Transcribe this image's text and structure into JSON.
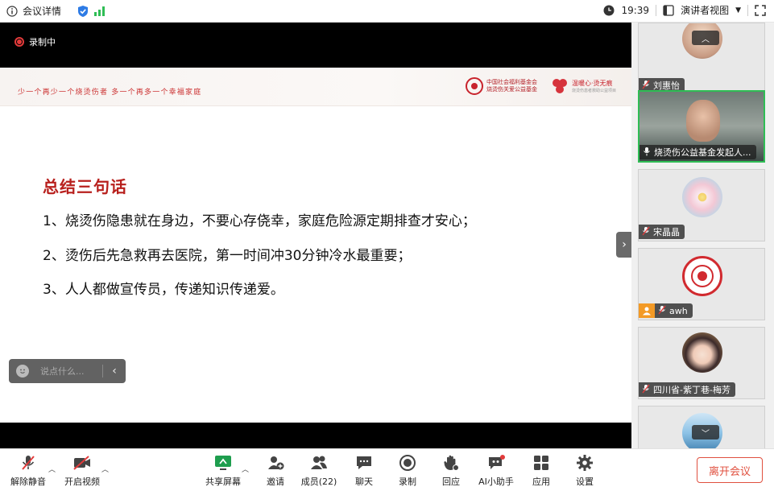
{
  "titlebar": {
    "title": "会议详情",
    "time": "19:39",
    "view_label": "演讲者视图"
  },
  "stage": {
    "recording_label": "录制中",
    "slide": {
      "slogan": "少一个再少一个烧烫伤者 多一个再多一个幸福家庭",
      "logo1_line1": "中国社会福利基金会",
      "logo1_line2": "烧烫伤关爱公益基金",
      "logo2_line1": "温暖心·烫无痕",
      "logo2_line2": "烧烫伤患者救助公益项目",
      "heading": "总结三句话",
      "lines": [
        "1、烧烫伤隐患就在身边，不要心存侥幸，家庭危险源定期排查才安心；",
        "2、烫伤后先急救再去医院，第一时间冲30分钟冷水最重要；",
        "3、人人都做宣传员，传递知识传递爱。"
      ]
    },
    "chat_placeholder": "说点什么..."
  },
  "participants": [
    {
      "name": "刘惠怡",
      "muted": true
    },
    {
      "name": "烧烫伤公益基金发起人...",
      "muted": false,
      "active": true
    },
    {
      "name": "宋晶晶",
      "muted": true
    },
    {
      "name": "awh",
      "muted": true
    },
    {
      "name": "四川省-紫丁巷-梅芳",
      "muted": true
    },
    {
      "name": "",
      "muted": true
    }
  ],
  "toolbar": {
    "unmute": "解除静音",
    "start_video": "开启视频",
    "share_screen": "共享屏幕",
    "invite": "邀请",
    "members": "成员(22)",
    "chat": "聊天",
    "record": "录制",
    "reactions": "回应",
    "ai_assistant": "AI小助手",
    "apps": "应用",
    "settings": "设置",
    "leave": "离开会议"
  },
  "colors": {
    "accent_green": "#2fbd55",
    "heading_red": "#b8201d",
    "leave_red": "#e0503f",
    "record_red": "#e23b3b"
  }
}
